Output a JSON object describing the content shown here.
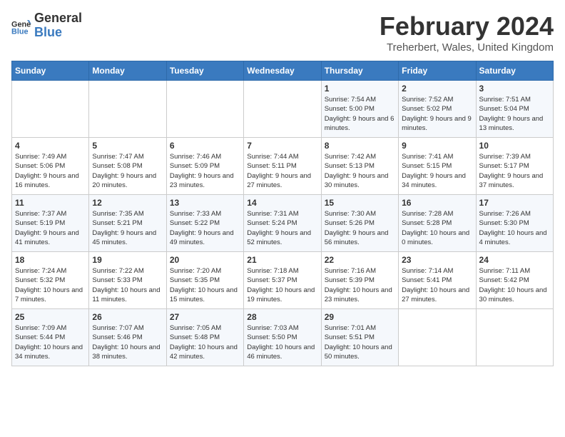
{
  "header": {
    "logo_line1": "General",
    "logo_line2": "Blue",
    "month": "February 2024",
    "location": "Treherbert, Wales, United Kingdom"
  },
  "days_of_week": [
    "Sunday",
    "Monday",
    "Tuesday",
    "Wednesday",
    "Thursday",
    "Friday",
    "Saturday"
  ],
  "weeks": [
    [
      {
        "day": "",
        "content": ""
      },
      {
        "day": "",
        "content": ""
      },
      {
        "day": "",
        "content": ""
      },
      {
        "day": "",
        "content": ""
      },
      {
        "day": "1",
        "content": "Sunrise: 7:54 AM\nSunset: 5:00 PM\nDaylight: 9 hours and 6 minutes."
      },
      {
        "day": "2",
        "content": "Sunrise: 7:52 AM\nSunset: 5:02 PM\nDaylight: 9 hours and 9 minutes."
      },
      {
        "day": "3",
        "content": "Sunrise: 7:51 AM\nSunset: 5:04 PM\nDaylight: 9 hours and 13 minutes."
      }
    ],
    [
      {
        "day": "4",
        "content": "Sunrise: 7:49 AM\nSunset: 5:06 PM\nDaylight: 9 hours and 16 minutes."
      },
      {
        "day": "5",
        "content": "Sunrise: 7:47 AM\nSunset: 5:08 PM\nDaylight: 9 hours and 20 minutes."
      },
      {
        "day": "6",
        "content": "Sunrise: 7:46 AM\nSunset: 5:09 PM\nDaylight: 9 hours and 23 minutes."
      },
      {
        "day": "7",
        "content": "Sunrise: 7:44 AM\nSunset: 5:11 PM\nDaylight: 9 hours and 27 minutes."
      },
      {
        "day": "8",
        "content": "Sunrise: 7:42 AM\nSunset: 5:13 PM\nDaylight: 9 hours and 30 minutes."
      },
      {
        "day": "9",
        "content": "Sunrise: 7:41 AM\nSunset: 5:15 PM\nDaylight: 9 hours and 34 minutes."
      },
      {
        "day": "10",
        "content": "Sunrise: 7:39 AM\nSunset: 5:17 PM\nDaylight: 9 hours and 37 minutes."
      }
    ],
    [
      {
        "day": "11",
        "content": "Sunrise: 7:37 AM\nSunset: 5:19 PM\nDaylight: 9 hours and 41 minutes."
      },
      {
        "day": "12",
        "content": "Sunrise: 7:35 AM\nSunset: 5:21 PM\nDaylight: 9 hours and 45 minutes."
      },
      {
        "day": "13",
        "content": "Sunrise: 7:33 AM\nSunset: 5:22 PM\nDaylight: 9 hours and 49 minutes."
      },
      {
        "day": "14",
        "content": "Sunrise: 7:31 AM\nSunset: 5:24 PM\nDaylight: 9 hours and 52 minutes."
      },
      {
        "day": "15",
        "content": "Sunrise: 7:30 AM\nSunset: 5:26 PM\nDaylight: 9 hours and 56 minutes."
      },
      {
        "day": "16",
        "content": "Sunrise: 7:28 AM\nSunset: 5:28 PM\nDaylight: 10 hours and 0 minutes."
      },
      {
        "day": "17",
        "content": "Sunrise: 7:26 AM\nSunset: 5:30 PM\nDaylight: 10 hours and 4 minutes."
      }
    ],
    [
      {
        "day": "18",
        "content": "Sunrise: 7:24 AM\nSunset: 5:32 PM\nDaylight: 10 hours and 7 minutes."
      },
      {
        "day": "19",
        "content": "Sunrise: 7:22 AM\nSunset: 5:33 PM\nDaylight: 10 hours and 11 minutes."
      },
      {
        "day": "20",
        "content": "Sunrise: 7:20 AM\nSunset: 5:35 PM\nDaylight: 10 hours and 15 minutes."
      },
      {
        "day": "21",
        "content": "Sunrise: 7:18 AM\nSunset: 5:37 PM\nDaylight: 10 hours and 19 minutes."
      },
      {
        "day": "22",
        "content": "Sunrise: 7:16 AM\nSunset: 5:39 PM\nDaylight: 10 hours and 23 minutes."
      },
      {
        "day": "23",
        "content": "Sunrise: 7:14 AM\nSunset: 5:41 PM\nDaylight: 10 hours and 27 minutes."
      },
      {
        "day": "24",
        "content": "Sunrise: 7:11 AM\nSunset: 5:42 PM\nDaylight: 10 hours and 30 minutes."
      }
    ],
    [
      {
        "day": "25",
        "content": "Sunrise: 7:09 AM\nSunset: 5:44 PM\nDaylight: 10 hours and 34 minutes."
      },
      {
        "day": "26",
        "content": "Sunrise: 7:07 AM\nSunset: 5:46 PM\nDaylight: 10 hours and 38 minutes."
      },
      {
        "day": "27",
        "content": "Sunrise: 7:05 AM\nSunset: 5:48 PM\nDaylight: 10 hours and 42 minutes."
      },
      {
        "day": "28",
        "content": "Sunrise: 7:03 AM\nSunset: 5:50 PM\nDaylight: 10 hours and 46 minutes."
      },
      {
        "day": "29",
        "content": "Sunrise: 7:01 AM\nSunset: 5:51 PM\nDaylight: 10 hours and 50 minutes."
      },
      {
        "day": "",
        "content": ""
      },
      {
        "day": "",
        "content": ""
      }
    ]
  ]
}
